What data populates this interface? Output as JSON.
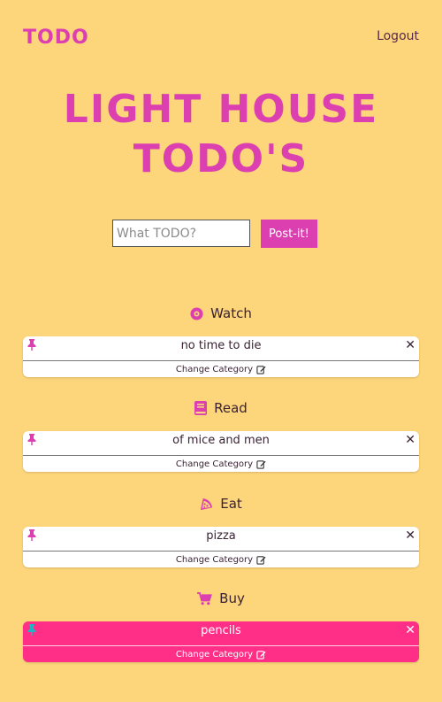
{
  "nav": {
    "brand": "TODO",
    "logout": "Logout"
  },
  "hero": {
    "line1": "LIGHT HOUSE",
    "line2": "TODO'S"
  },
  "form": {
    "placeholder": "What TODO?",
    "button": "Post-it!"
  },
  "change_label": "Change Category",
  "categories": [
    {
      "name": "Watch",
      "icon": "film-reel-icon",
      "items": [
        {
          "text": "no time to die"
        }
      ]
    },
    {
      "name": "Read",
      "icon": "book-icon",
      "items": [
        {
          "text": "of mice and men"
        }
      ]
    },
    {
      "name": "Eat",
      "icon": "pizza-icon",
      "items": [
        {
          "text": "pizza"
        }
      ]
    },
    {
      "name": "Buy",
      "icon": "cart-icon",
      "items": [
        {
          "text": "pencils"
        }
      ]
    }
  ],
  "colors": {
    "background": "#fdd57a",
    "accent": "#db3fb0",
    "highlight": "#ff2e86",
    "pin_highlight": "#1fb5c4"
  }
}
